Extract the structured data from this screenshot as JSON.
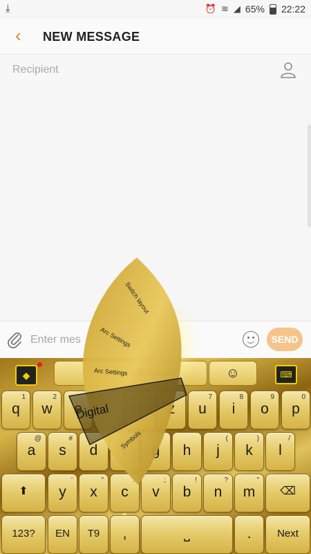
{
  "status": {
    "battery": "65%",
    "time": "22:22"
  },
  "header": {
    "title": "NEW MESSAGE"
  },
  "recipient": {
    "placeholder": "Recipient"
  },
  "compose": {
    "placeholder": "Enter mes",
    "send_label": "SEND"
  },
  "keyboard": {
    "language": "English",
    "row1": [
      {
        "k": "q",
        "h": "1"
      },
      {
        "k": "w",
        "h": "2"
      },
      {
        "k": "e",
        "h": ""
      },
      {
        "k": "r",
        "h": ""
      },
      {
        "k": "t",
        "h": ""
      },
      {
        "k": "z",
        "h": ""
      },
      {
        "k": "u",
        "h": "7"
      },
      {
        "k": "i",
        "h": "8"
      },
      {
        "k": "o",
        "h": "9"
      },
      {
        "k": "p",
        "h": "0"
      }
    ],
    "row2": [
      {
        "k": "a",
        "h": "@"
      },
      {
        "k": "s",
        "h": "#"
      },
      {
        "k": "d",
        "h": ""
      },
      {
        "k": "f",
        "h": ""
      },
      {
        "k": "g",
        "h": ""
      },
      {
        "k": "h",
        "h": ""
      },
      {
        "k": "j",
        "h": "("
      },
      {
        "k": "k",
        "h": ")"
      },
      {
        "k": "l",
        "h": "/"
      }
    ],
    "row3": [
      {
        "k": "y",
        "h": "'"
      },
      {
        "k": "x",
        "h": "\""
      },
      {
        "k": "c",
        "h": ":"
      },
      {
        "k": "v",
        "h": ";"
      },
      {
        "k": "b",
        "h": "!"
      },
      {
        "k": "n",
        "h": "?"
      },
      {
        "k": "m",
        "h": "\""
      }
    ],
    "row4": {
      "sym": "123?",
      "lang": "EN",
      "t9": "T9",
      "comma": ",",
      "period": ".",
      "next": "Next"
    },
    "arc_menu": {
      "items": [
        "Switch layout",
        "Arc Settings",
        "Arc Settings",
        "Symbols"
      ],
      "selected": "Digital"
    }
  },
  "colors": {
    "accent": "#e08a1e",
    "send_bg": "#f6c48a",
    "gold": "#d9b64a"
  }
}
